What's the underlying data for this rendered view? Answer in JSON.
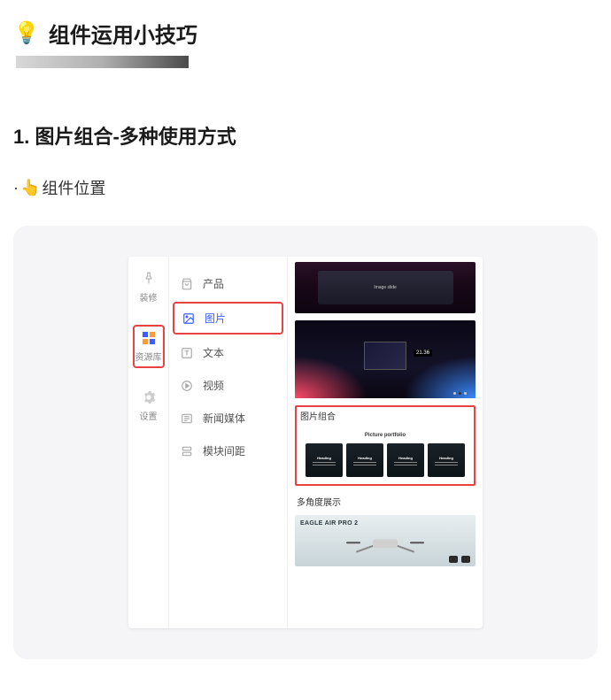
{
  "header": {
    "bulb": "💡",
    "title": "组件运用小技巧"
  },
  "section": {
    "heading": "1. 图片组合-多种使用方式",
    "subpoint_prefix": "·",
    "subpoint_icon": "👆",
    "subpoint_text": "组件位置"
  },
  "leftNav": [
    {
      "key": "decorate",
      "label": "装修"
    },
    {
      "key": "library",
      "label": "资源库"
    },
    {
      "key": "settings",
      "label": "设置"
    }
  ],
  "menu": [
    {
      "key": "product",
      "label": "产品"
    },
    {
      "key": "image",
      "label": "图片"
    },
    {
      "key": "text",
      "label": "文本"
    },
    {
      "key": "video",
      "label": "视频"
    },
    {
      "key": "news",
      "label": "新闻媒体"
    },
    {
      "key": "spacing",
      "label": "模块间距"
    }
  ],
  "preview": {
    "laptop_text": "Image slide",
    "rgb_clock": "21.36",
    "portfolio_section_label": "图片组合",
    "portfolio_title": "Picture portfolio",
    "portfolio_cards": [
      {
        "title": "Heading"
      },
      {
        "title": "Heading"
      },
      {
        "title": "Heading"
      },
      {
        "title": "Heading"
      }
    ],
    "multi_label": "多角度展示",
    "drone_title": "EAGLE AIR PRO 2"
  }
}
